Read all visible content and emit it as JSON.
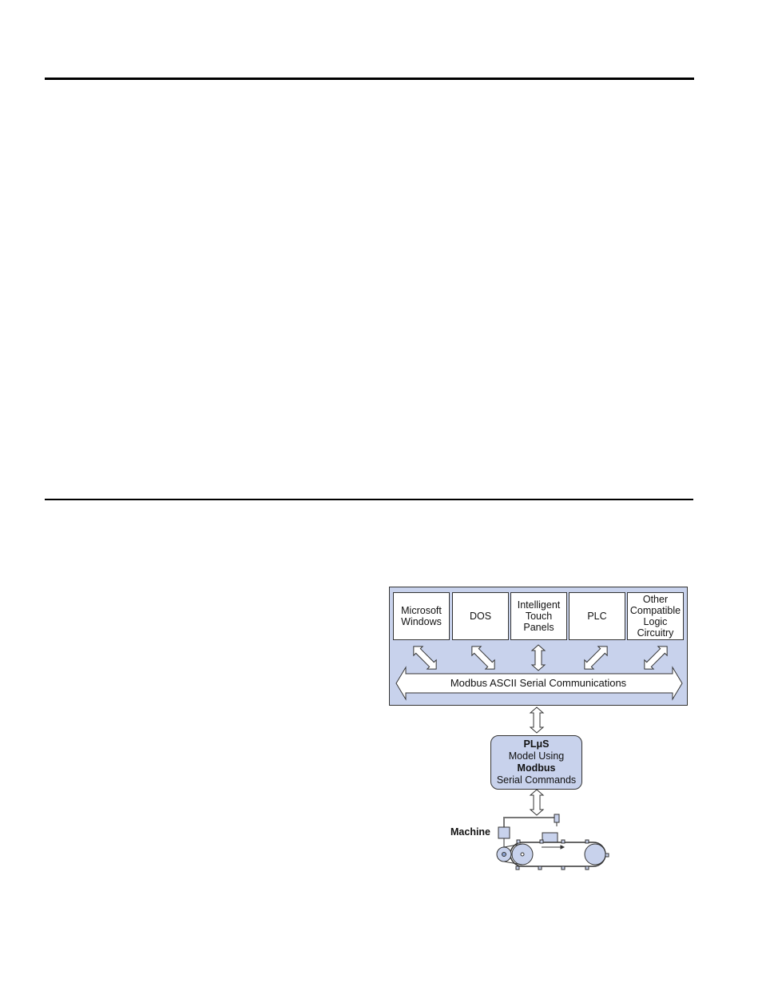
{
  "page": {
    "rules": [
      "top-rule",
      "section-rule"
    ]
  },
  "diagram": {
    "systems": [
      {
        "id": "microsoft-windows",
        "lines": [
          "Microsoft",
          "Windows"
        ]
      },
      {
        "id": "dos",
        "lines": [
          "DOS"
        ]
      },
      {
        "id": "intelligent-touch-panels",
        "lines": [
          "Intelligent",
          "Touch",
          "Panels"
        ]
      },
      {
        "id": "plc",
        "lines": [
          "PLC"
        ]
      },
      {
        "id": "other-logic",
        "lines": [
          "Other",
          "Compatible",
          "Logic",
          "Circuitry"
        ]
      }
    ],
    "bus_label": "Modbus ASCII Serial Communications",
    "controller": {
      "line1": "PLμS",
      "line2": "Model Using",
      "line3": "Modbus",
      "line4": "Serial Commands"
    },
    "machine_label": "Machine",
    "colors": {
      "panel_fill": "#c8d2ec",
      "outline": "#333333",
      "box_fill": "#ffffff"
    },
    "icons": [
      "double-arrow-icon",
      "conveyor-machine-icon"
    ]
  }
}
